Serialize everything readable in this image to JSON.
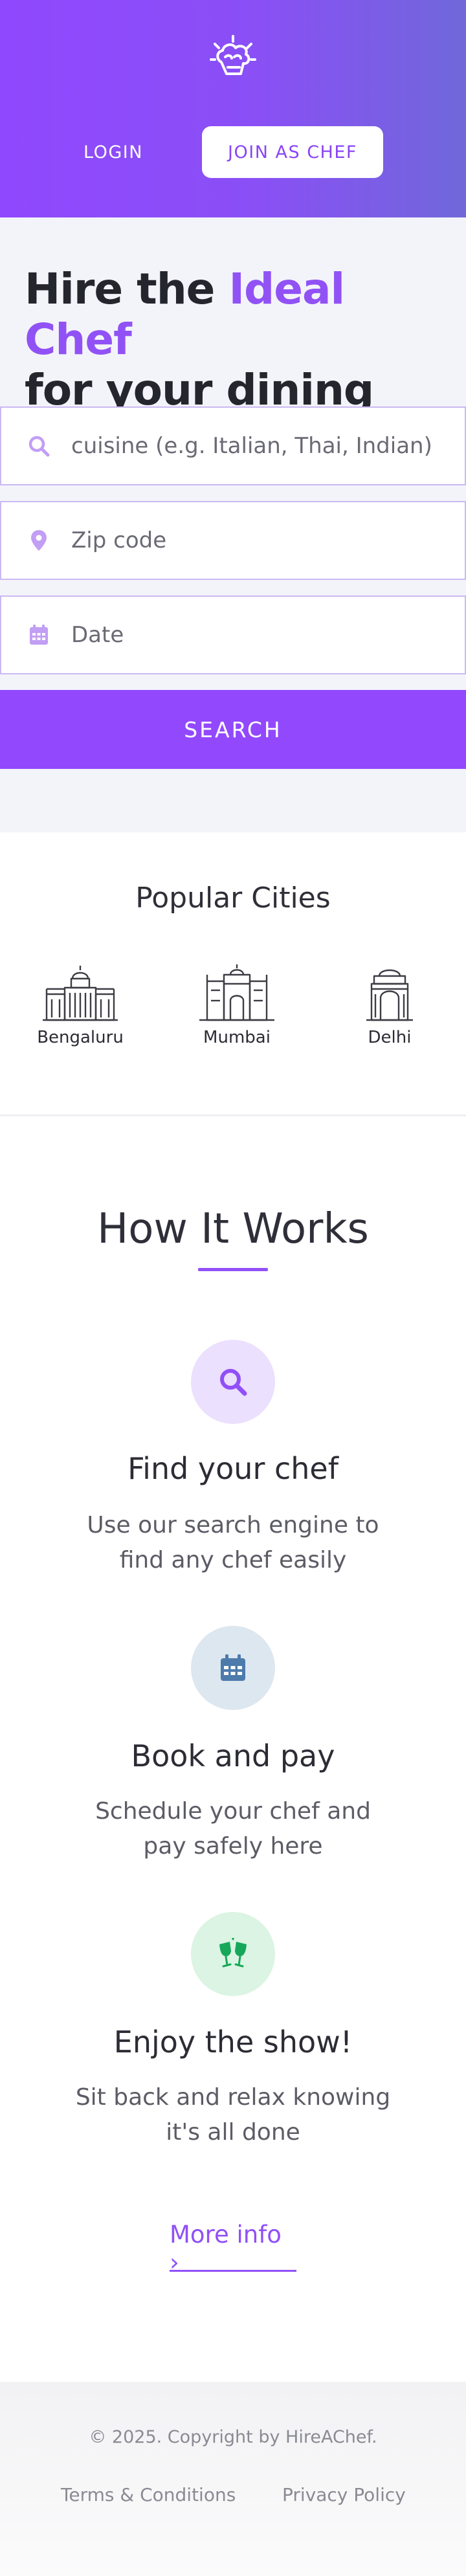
{
  "header": {
    "logo": "chef-hat-logo",
    "login_label": "LOGIN",
    "join_label": "JOIN AS CHEF"
  },
  "hero": {
    "headline_part1": "Hire the ",
    "headline_accent": "Ideal Chef",
    "headline_part2": "for your dining"
  },
  "search": {
    "cuisine_placeholder": "cuisine (e.g. Italian, Thai, Indian)",
    "zip_placeholder": "Zip code",
    "date_placeholder": "Date",
    "button_label": "SEARCH",
    "icons": [
      "search-icon",
      "location-pin-icon",
      "calendar-icon"
    ]
  },
  "cities": {
    "title": "Popular Cities",
    "items": [
      {
        "name": "Bengaluru",
        "icon": "bengaluru-landmark-icon"
      },
      {
        "name": "Mumbai",
        "icon": "mumbai-landmark-icon"
      },
      {
        "name": "Delhi",
        "icon": "delhi-landmark-icon"
      }
    ]
  },
  "how": {
    "title": "How It Works",
    "steps": [
      {
        "title": "Find your chef",
        "desc": "Use our search engine to find any chef easily",
        "icon": "search-icon"
      },
      {
        "title": "Book and pay",
        "desc": "Schedule your chef and pay safely here",
        "icon": "calendar-icon"
      },
      {
        "title": "Enjoy the show!",
        "desc": "Sit back and relax knowing it's all done",
        "icon": "cheers-glasses-icon"
      }
    ],
    "more_label": "More info ›"
  },
  "footer": {
    "copyright": "© 2025. Copyright by HireAChef.",
    "terms": "Terms & Conditions",
    "privacy": "Privacy Policy"
  },
  "colors": {
    "accent": "#9249fd",
    "header_gradient_start": "#9048fe",
    "header_gradient_end": "#7068da",
    "step1_bg": "#ebe0fd",
    "step2_bg": "#dde7f0",
    "step3_bg": "#dbf4e3"
  }
}
